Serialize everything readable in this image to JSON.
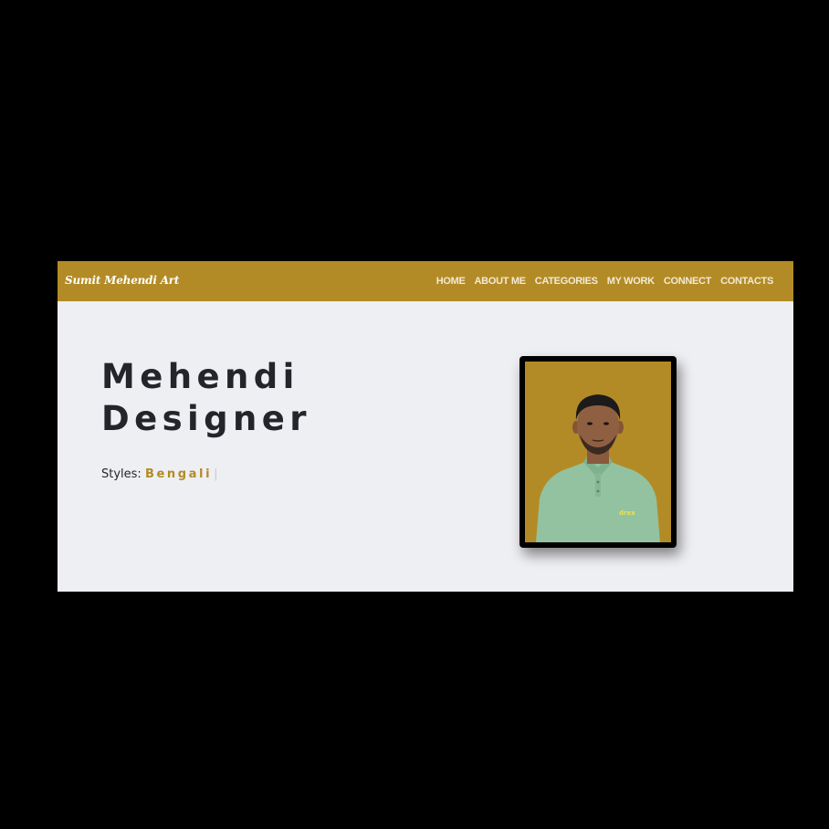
{
  "navbar": {
    "brand": "Sumit Mehendi Art",
    "links": [
      {
        "label": "HOME"
      },
      {
        "label": "ABOUT ME"
      },
      {
        "label": "CATEGORIES"
      },
      {
        "label": "MY WORK"
      },
      {
        "label": "CONNECT"
      },
      {
        "label": "CONTACTS"
      }
    ]
  },
  "hero": {
    "title_line1": "Mehendi",
    "title_line2": "Designer",
    "styles_label": "Styles:",
    "styles_value": "Bengali",
    "typing_cursor": "|",
    "shirt_logo_text": "drex"
  },
  "colors": {
    "accent": "#b38b26",
    "background": "#eeeff3",
    "text": "#24252a"
  }
}
